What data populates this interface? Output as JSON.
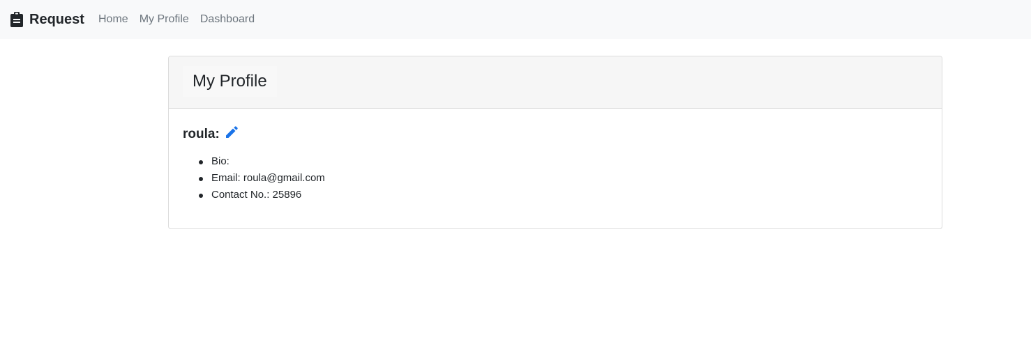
{
  "navbar": {
    "brand": {
      "text": "Request",
      "icon": "clipboard-icon"
    },
    "links": [
      {
        "label": "Home"
      },
      {
        "label": "My Profile"
      },
      {
        "label": "Dashboard"
      }
    ]
  },
  "profile_card": {
    "title": "My Profile",
    "username": "roula:",
    "edit_icon": "pencil-icon",
    "details": [
      {
        "label": "Bio:",
        "value": ""
      },
      {
        "label": "Email:",
        "value": "roula@gmail.com"
      },
      {
        "label": "Contact No.:",
        "value": "25896"
      }
    ]
  },
  "colors": {
    "navbar_bg": "#f8f9fa",
    "nav_link": "#6c757d",
    "accent": "#1a73e8",
    "text": "#212529",
    "card_header_bg": "#f6f6f6",
    "card_border": "#dcdcdc"
  }
}
